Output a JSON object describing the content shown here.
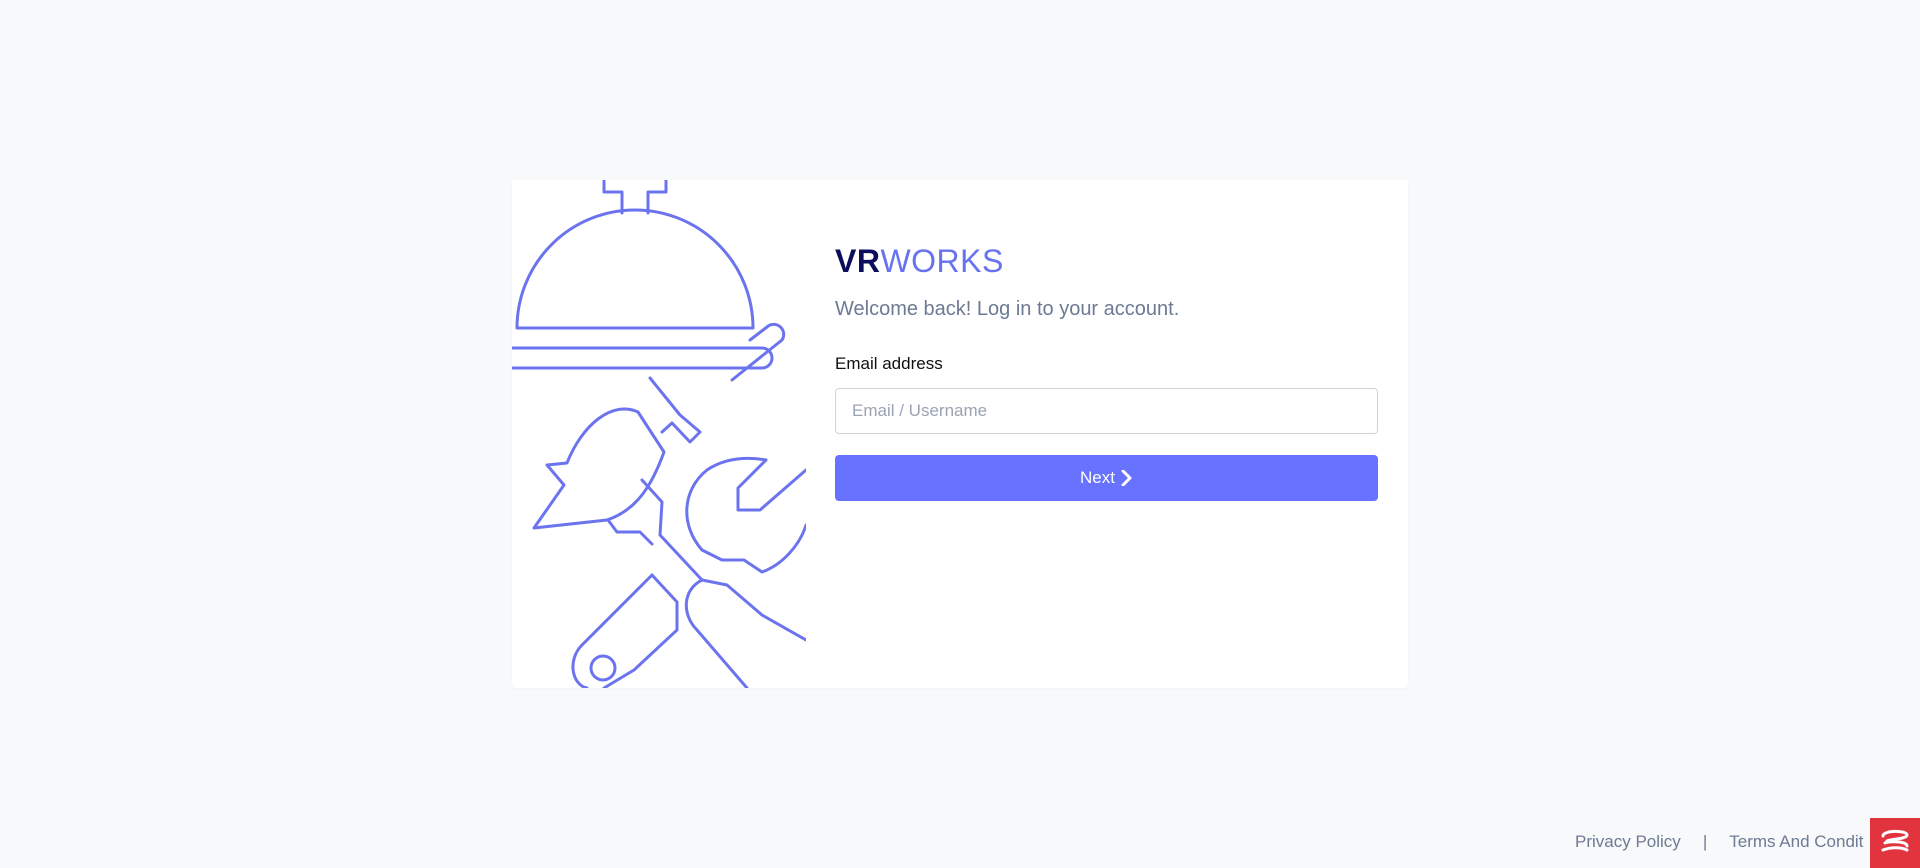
{
  "brand": {
    "strong": "VR",
    "light": "WORKS"
  },
  "login": {
    "welcome": "Welcome back! Log in to your account.",
    "email_label": "Email address",
    "email_placeholder": "Email / Username",
    "email_value": "",
    "next_label": "Next"
  },
  "footer": {
    "privacy": "Privacy Policy",
    "separator": "|",
    "terms": "Terms And Condit"
  },
  "icons": {
    "illustration": [
      "cloche-icon",
      "leaf-icon",
      "wrench-icon",
      "screwdriver-icon"
    ],
    "next": "chevron-right-icon",
    "chat": "chat-icon"
  },
  "colors": {
    "accent": "#6772fe",
    "brand_dark": "#0c0e5c",
    "illustration_stroke": "#6b74ee",
    "chat_widget": "#e2343f"
  }
}
